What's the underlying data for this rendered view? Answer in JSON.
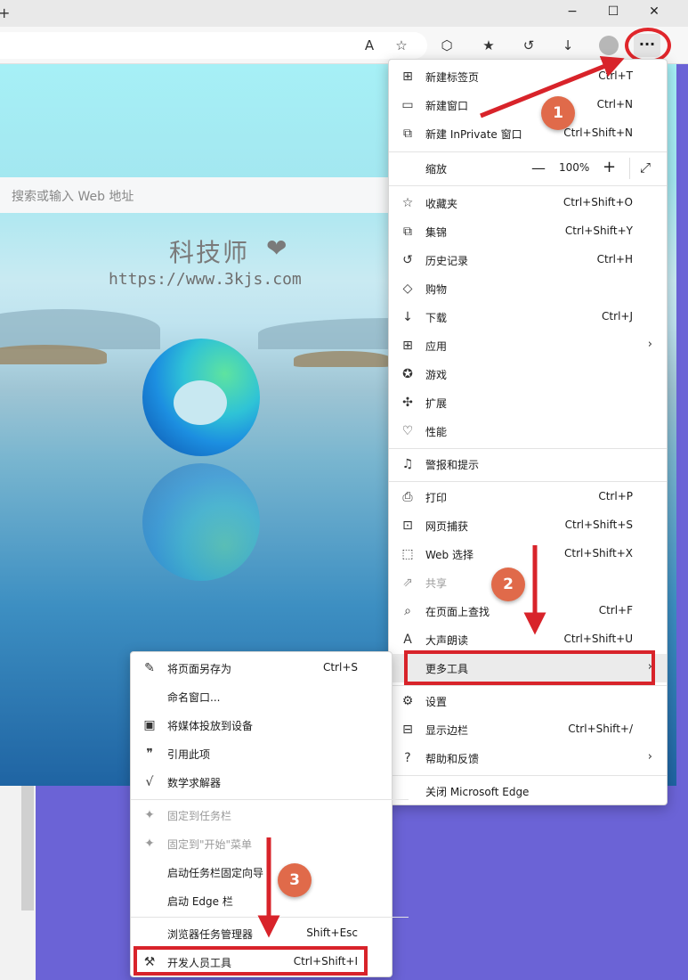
{
  "window": {
    "new_tab_glyph": "+",
    "minimize": "−",
    "maximize": "☐",
    "close": "✕"
  },
  "toolbar": {
    "read_aloud_icon": "A",
    "favorite_icon": "☆",
    "extensions_icon": "⬡",
    "favorites_icon": "★",
    "history_icon": "↺",
    "downloads_icon": "↓",
    "more_icon": "···"
  },
  "page": {
    "search_placeholder": "搜索或输入 Web 地址",
    "watermark_title": "科技师",
    "watermark_heart": "❤",
    "watermark_url": "https://www.3kjs.com"
  },
  "menu": {
    "new_tab": {
      "label": "新建标签页",
      "shortcut": "Ctrl+T"
    },
    "new_window": {
      "label": "新建窗口",
      "shortcut": "Ctrl+N"
    },
    "new_inprivate": {
      "label": "新建 InPrivate 窗口",
      "shortcut": "Ctrl+Shift+N"
    },
    "zoom": {
      "label": "缩放",
      "minus": "—",
      "value": "100%",
      "plus": "+",
      "fullscreen": "⤢"
    },
    "favorites": {
      "label": "收藏夹",
      "shortcut": "Ctrl+Shift+O"
    },
    "collections": {
      "label": "集锦",
      "shortcut": "Ctrl+Shift+Y"
    },
    "history": {
      "label": "历史记录",
      "shortcut": "Ctrl+H"
    },
    "shopping": {
      "label": "购物"
    },
    "downloads": {
      "label": "下载",
      "shortcut": "Ctrl+J"
    },
    "apps": {
      "label": "应用",
      "arrow": "›"
    },
    "games": {
      "label": "游戏"
    },
    "extensions": {
      "label": "扩展"
    },
    "performance": {
      "label": "性能"
    },
    "alerts": {
      "label": "警报和提示"
    },
    "print": {
      "label": "打印",
      "shortcut": "Ctrl+P"
    },
    "web_capture": {
      "label": "网页捕获",
      "shortcut": "Ctrl+Shift+S"
    },
    "web_select": {
      "label": "Web 选择",
      "shortcut": "Ctrl+Shift+X"
    },
    "share": {
      "label": "共享"
    },
    "find": {
      "label": "在页面上查找",
      "shortcut": "Ctrl+F"
    },
    "read_aloud": {
      "label": "大声朗读",
      "shortcut": "Ctrl+Shift+U"
    },
    "more_tools": {
      "label": "更多工具",
      "arrow": "›"
    },
    "settings": {
      "label": "设置"
    },
    "sidebar": {
      "label": "显示边栏",
      "shortcut": "Ctrl+Shift+/"
    },
    "help": {
      "label": "帮助和反馈",
      "arrow": "›"
    },
    "close_edge": {
      "label": "关闭 Microsoft Edge"
    }
  },
  "submenu": {
    "save_as": {
      "label": "将页面另存为",
      "shortcut": "Ctrl+S"
    },
    "name_window": {
      "label": "命名窗口..."
    },
    "cast": {
      "label": "将媒体投放到设备"
    },
    "cite": {
      "label": "引用此项"
    },
    "math_solver": {
      "label": "数学求解器"
    },
    "pin_taskbar": {
      "label": "固定到任务栏"
    },
    "pin_start": {
      "label": "固定到\"开始\"菜单"
    },
    "pin_wizard": {
      "label": "启动任务栏固定向导"
    },
    "edge_bar": {
      "label": "启动 Edge 栏"
    },
    "task_manager": {
      "label": "浏览器任务管理器",
      "shortcut": "Shift+Esc"
    },
    "dev_tools": {
      "label": "开发人员工具",
      "shortcut": "Ctrl+Shift+I"
    }
  },
  "annotations": {
    "step1": "1",
    "step2": "2",
    "step3": "3",
    "color": "#d8232a"
  }
}
